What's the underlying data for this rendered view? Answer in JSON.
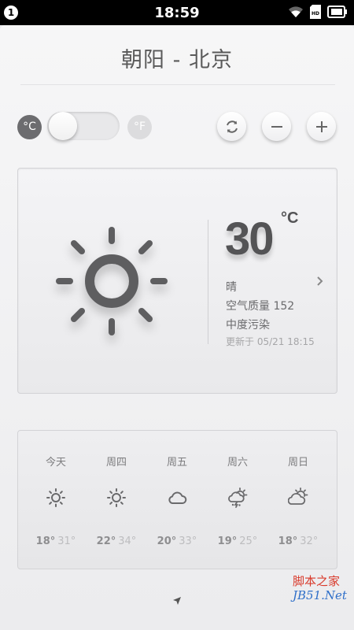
{
  "status_bar": {
    "notification_count": "1",
    "time": "18:59",
    "icons": [
      "wifi-icon",
      "hd-icon",
      "battery-icon"
    ]
  },
  "header": {
    "title": "朝阳 - 北京"
  },
  "units": {
    "celsius": "°C",
    "fahrenheit": "°F",
    "selected": "celsius"
  },
  "toolbar": {
    "icons": [
      "refresh-icon",
      "remove-city-icon",
      "add-city-icon"
    ]
  },
  "current": {
    "temperature": "30",
    "unit": "°C",
    "condition": "晴",
    "air_quality": "空气质量 152",
    "pollution": "中度污染",
    "updated": "更新于 05/21 18:15",
    "icon": "sunny-icon"
  },
  "forecast": [
    {
      "day": "今天",
      "icon": "sunny-icon",
      "low": "18°",
      "high": "31°"
    },
    {
      "day": "周四",
      "icon": "sunny-icon",
      "low": "22°",
      "high": "34°"
    },
    {
      "day": "周五",
      "icon": "cloudy-icon",
      "low": "20°",
      "high": "33°"
    },
    {
      "day": "周六",
      "icon": "thunderstorm-icon",
      "low": "19°",
      "high": "25°"
    },
    {
      "day": "周日",
      "icon": "partly-cloudy-icon",
      "low": "18°",
      "high": "32°"
    }
  ],
  "watermark": {
    "line1": "脚本之家",
    "line2": "JB51.Net"
  },
  "colors": {
    "accent": "#6c6c6f",
    "watermark_red": "#d93a2b",
    "watermark_blue": "#2f6fc9"
  }
}
